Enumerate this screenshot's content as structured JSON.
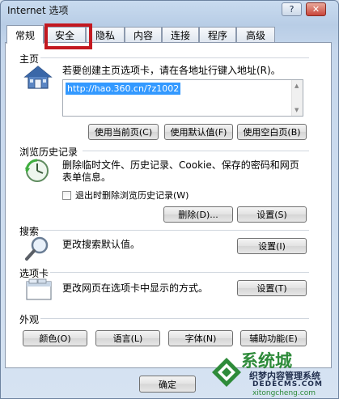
{
  "window": {
    "title": "Internet 选项",
    "help_label": "?",
    "close_label": "✕"
  },
  "tabs": [
    {
      "label": "常规"
    },
    {
      "label": "安全"
    },
    {
      "label": "隐私"
    },
    {
      "label": "内容"
    },
    {
      "label": "连接"
    },
    {
      "label": "程序"
    },
    {
      "label": "高级"
    }
  ],
  "home": {
    "heading": "主页",
    "description": "若要创建主页选项卡，请在各地址行键入地址(R)。",
    "url": "http://hao.360.cn/?z1002",
    "use_current": "使用当前页(C)",
    "use_default": "使用默认值(F)",
    "use_blank": "使用空白页(B)"
  },
  "history": {
    "heading": "浏览历史记录",
    "description": "删除临时文件、历史记录、Cookie、保存的密码和网页表单信息。",
    "delete_on_exit": "退出时删除浏览历史记录(W)",
    "delete_on_exit_checked": false,
    "delete_button": "删除(D)...",
    "settings_button": "设置(S)"
  },
  "search": {
    "heading": "搜索",
    "description": "更改搜索默认值。",
    "settings_button": "设置(I)"
  },
  "tabs_section": {
    "heading": "选项卡",
    "description": "更改网页在选项卡中显示的方式。",
    "settings_button": "设置(T)"
  },
  "appearance": {
    "heading": "外观",
    "colors": "颜色(O)",
    "languages": "语言(L)",
    "fonts": "字体(N)",
    "accessibility": "辅助功能(E)"
  },
  "footer": {
    "ok_button": "确定"
  },
  "watermark": {
    "line1": "系统城",
    "line2": "织梦内容管理系统",
    "line3": "DEDECMS.COM",
    "line4": "xitongcheng.com"
  },
  "colors": {
    "highlight_box": "#c31820",
    "selection": "#3399ff",
    "watermark_green": "#2e8b3a"
  }
}
